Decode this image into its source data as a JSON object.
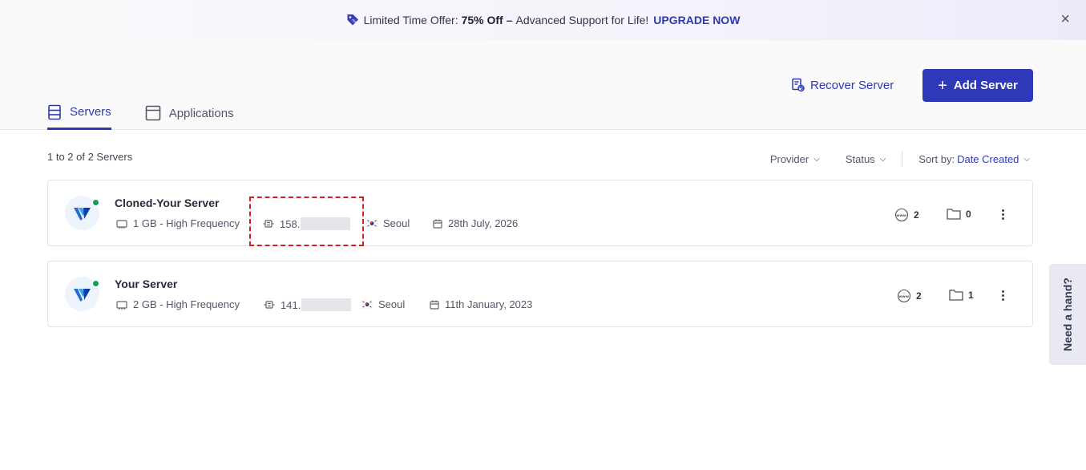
{
  "banner": {
    "prefix": "Limited Time Offer:",
    "discount": "75% Off",
    "separator": "–",
    "suffix": "Advanced Support for Life!",
    "cta": "UPGRADE NOW",
    "close": "×"
  },
  "header": {
    "recover_label": "Recover Server",
    "add_label": "Add Server",
    "add_plus": "+"
  },
  "tabs": [
    {
      "label": "Servers",
      "icon": "server-icon",
      "active": true
    },
    {
      "label": "Applications",
      "icon": "window-icon",
      "active": false
    }
  ],
  "list": {
    "count_text": "1 to 2 of 2 Servers",
    "filters": {
      "provider": "Provider",
      "status": "Status",
      "sort_label": "Sort by:",
      "sort_value": "Date Created"
    }
  },
  "servers": [
    {
      "name": "Cloned-Your Server",
      "size": "1 GB - High Frequency",
      "ip_prefix": "158.",
      "location": "Seoul",
      "created": "28th July, 2026",
      "websites": "2",
      "folders": "0"
    },
    {
      "name": "Your Server",
      "size": "2 GB - High Frequency",
      "ip_prefix": "141.",
      "location": "Seoul",
      "created": "11th January, 2023",
      "websites": "2",
      "folders": "1"
    }
  ],
  "help": {
    "label": "Need a hand?"
  },
  "colors": {
    "primary": "#2f38b8",
    "status_online": "#1d9b5c",
    "highlight": "#d51f1f"
  }
}
